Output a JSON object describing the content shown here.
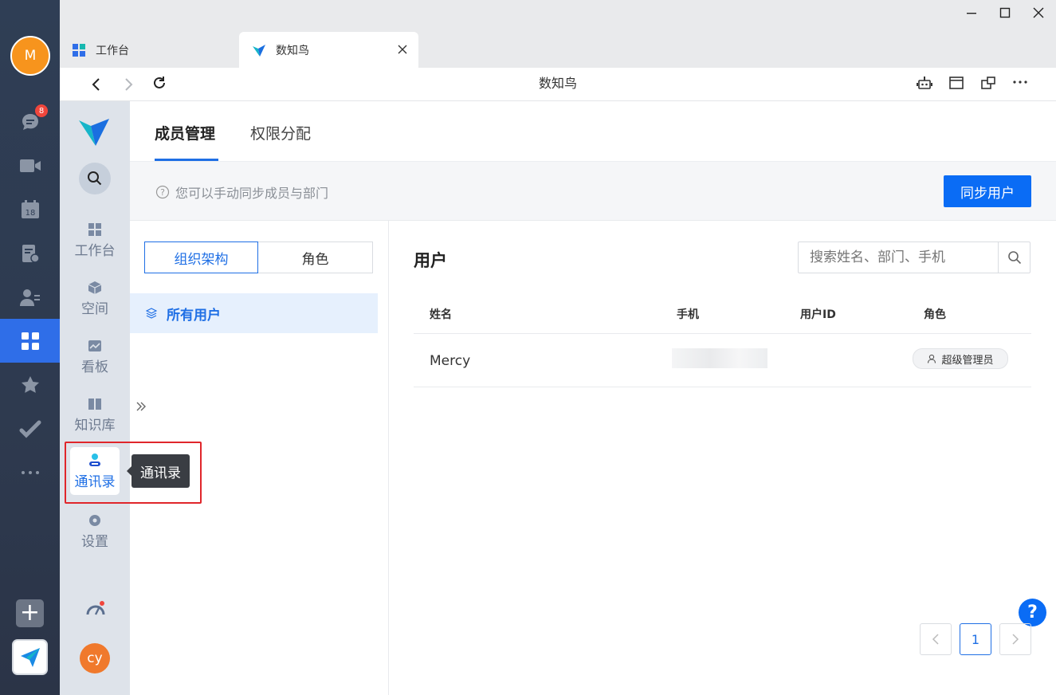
{
  "rail": {
    "avatar_letter": "M",
    "chat_badge": "8",
    "calendar_day": "18"
  },
  "tabs": [
    {
      "label": "工作台"
    },
    {
      "label": "数知鸟"
    }
  ],
  "addressbar": {
    "title": "数知鸟"
  },
  "nav": {
    "items": [
      {
        "label": "工作台"
      },
      {
        "label": "空间"
      },
      {
        "label": "看板"
      },
      {
        "label": "知识库"
      },
      {
        "label": "通讯录"
      },
      {
        "label": "设置"
      }
    ],
    "user_initials": "cy",
    "tooltip": "通讯录"
  },
  "main": {
    "tabs": [
      {
        "label": "成员管理"
      },
      {
        "label": "权限分配"
      }
    ],
    "tip": "您可以手动同步成员与部门",
    "sync_button": "同步用户",
    "segments": [
      {
        "label": "组织架构"
      },
      {
        "label": "角色"
      }
    ],
    "tree_item": "所有用户",
    "users_title": "用户",
    "search_placeholder": "搜索姓名、部门、手机",
    "columns": [
      "姓名",
      "手机",
      "用户ID",
      "角色"
    ],
    "rows": [
      {
        "name": "Mercy",
        "phone": "",
        "user_id": "",
        "role": "超级管理员"
      }
    ],
    "page": "1"
  },
  "colors": {
    "accent": "#0a6cf5",
    "rail_bg": "#2f3e55",
    "nav_bg": "#dee3ea",
    "highlight_box": "#e0262b"
  }
}
